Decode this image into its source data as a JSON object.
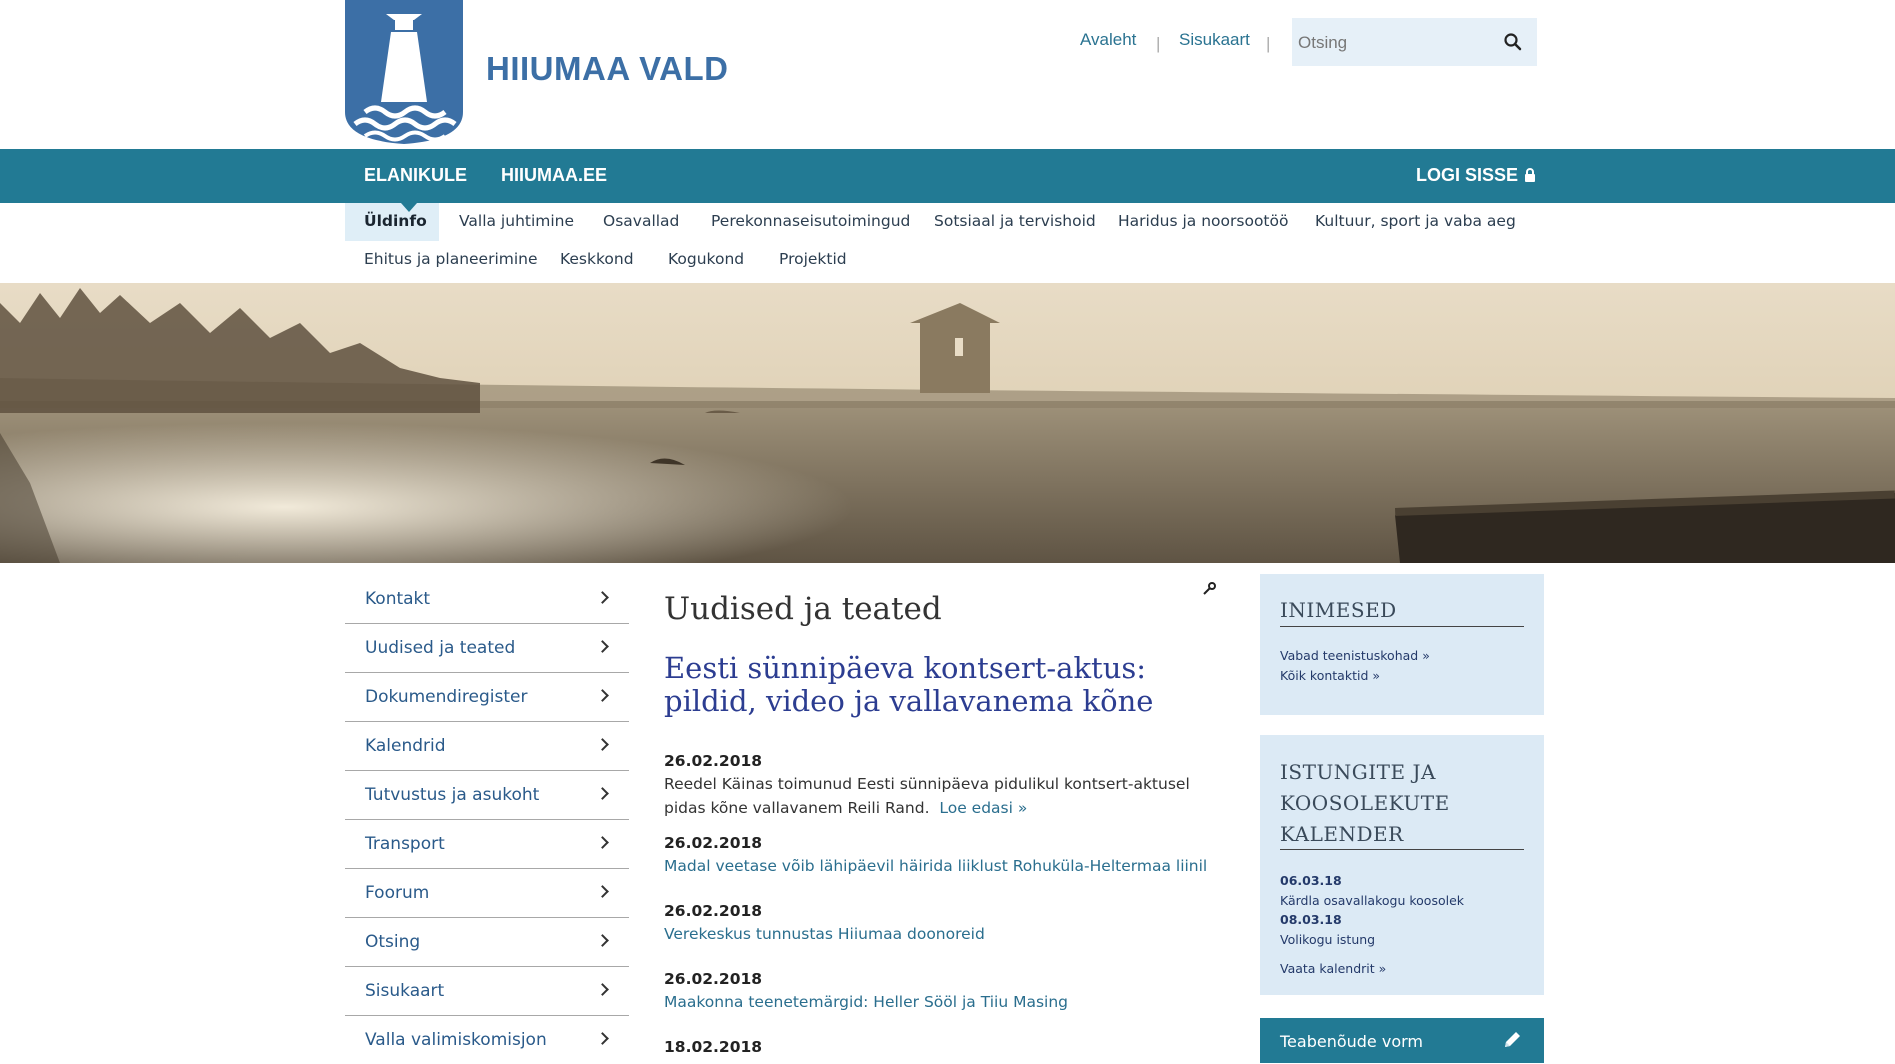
{
  "site": {
    "name": "HIIUMAA VALD"
  },
  "top_links": {
    "home": "Avaleht",
    "sitemap": "Sisukaart",
    "separator": "|"
  },
  "search": {
    "placeholder": "Otsing"
  },
  "main_nav": {
    "items": [
      "ELANIKULE",
      "HIIUMAA.EE"
    ],
    "login": "LOGI SISSE"
  },
  "sub_nav": {
    "row1": [
      "Üldinfo",
      "Valla juhtimine",
      "Osavallad",
      "Perekonnaseisutoimingud",
      "Sotsiaal ja tervishoid",
      "Haridus ja noorsootöö",
      "Kultuur, sport ja vaba aeg"
    ],
    "row2": [
      "Ehitus ja planeerimine",
      "Keskkond",
      "Kogukond",
      "Projektid"
    ],
    "active": "Üldinfo"
  },
  "left_menu": [
    "Kontakt",
    "Uudised ja teated",
    "Dokumendiregister",
    "Kalendrid",
    "Tutvustus ja asukoht",
    "Transport",
    "Foorum",
    "Otsing",
    "Sisukaart",
    "Valla valimiskomisjon"
  ],
  "main": {
    "title": "Uudised ja teated",
    "lead_title": "Eesti sünnipäeva kontsert-aktus: pildid, video ja vallavanema kõne",
    "news": [
      {
        "date": "26.02.2018",
        "text": "Reedel Käinas toimunud Eesti sünnipäeva pidulikul kontsert-aktusel pidas kõne vallavanem Reili Rand.",
        "more": "Loe edasi »"
      },
      {
        "date": "26.02.2018",
        "link": "Madal veetase võib lähipäevil häirida liiklust Rohuküla-Heltermaa liinil"
      },
      {
        "date": "26.02.2018",
        "link": "Verekeskus tunnustas Hiiumaa doonoreid"
      },
      {
        "date": "26.02.2018",
        "link": "Maakonna teenetemärgid: Heller Sööl ja Tiiu Masing"
      },
      {
        "date": "18.02.2018"
      }
    ]
  },
  "sidebar": {
    "people": {
      "title": "INIMESED",
      "links": [
        "Vabad teenistuskohad »",
        "Kõik kontaktid »"
      ]
    },
    "calendar": {
      "title_lines": [
        "ISTUNGITE JA",
        "KOOSOLEKUTE",
        "KALENDER"
      ],
      "events": [
        {
          "date": "06.03.18",
          "title": "Kärdla osavallakogu koosolek"
        },
        {
          "date": "08.03.18",
          "title": "Volikogu istung"
        }
      ],
      "link": "Vaata kalendrit »"
    },
    "form_button": "Teabenõude vorm"
  },
  "colors": {
    "accent": "#227a94",
    "brand_blue": "#3c6fa6",
    "panel": "#dceaf5",
    "headline": "#2c3d91"
  }
}
